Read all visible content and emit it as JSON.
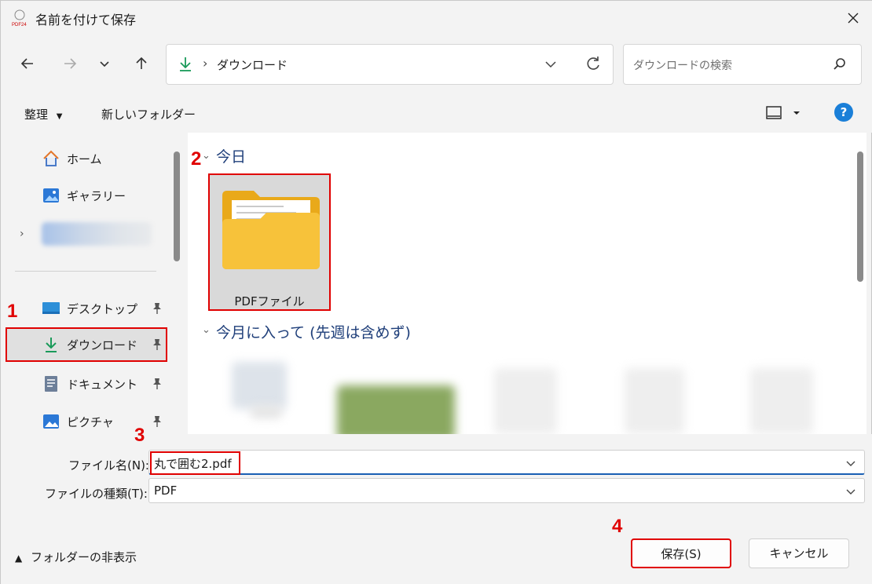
{
  "window": {
    "title": "名前を付けて保存"
  },
  "nav": {
    "path": "ダウンロード",
    "search_placeholder": "ダウンロードの検索"
  },
  "toolbar": {
    "organize": "整理",
    "new_folder": "新しいフォルダー"
  },
  "sidebar": {
    "items": [
      {
        "label": "ホーム",
        "icon": "home-icon"
      },
      {
        "label": "ギャラリー",
        "icon": "gallery-icon"
      },
      {
        "label": "デスクトップ",
        "icon": "desktop-icon"
      },
      {
        "label": "ダウンロード",
        "icon": "download-icon"
      },
      {
        "label": "ドキュメント",
        "icon": "document-icon"
      },
      {
        "label": "ピクチャ",
        "icon": "pictures-icon"
      }
    ]
  },
  "content": {
    "group_today": "今日",
    "group_this_month": "今月に入って (先週は含めず)",
    "folder_name": "PDFファイル"
  },
  "form": {
    "filename_label": "ファイル名(N):",
    "filename_value": "丸で囲む2.pdf",
    "filetype_label": "ファイルの種類(T):",
    "filetype_value": "PDF",
    "hide_folders": "フォルダーの非表示",
    "save": "保存(S)",
    "cancel": "キャンセル"
  },
  "annotations": [
    "1",
    "2",
    "3",
    "4"
  ],
  "colors": {
    "accent": "#1a7fd8",
    "annotation": "#e00000",
    "folder": "#f7c23a"
  }
}
